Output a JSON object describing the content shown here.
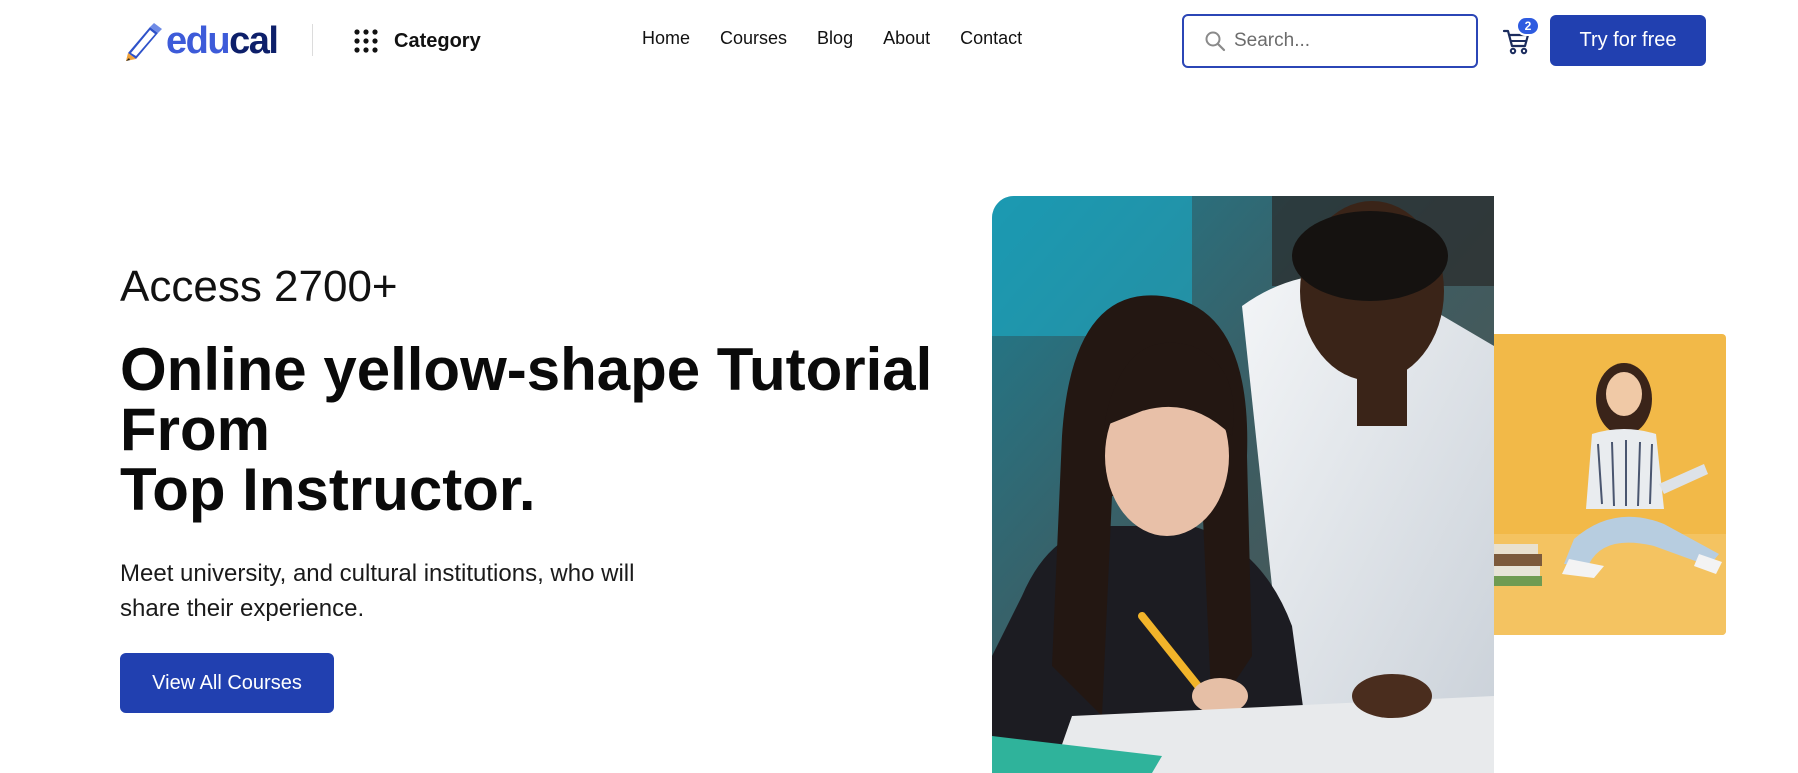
{
  "header": {
    "logo": {
      "part1": "edu",
      "part2": "cal",
      "icon": "pencil-logo-icon"
    },
    "category_label": "Category",
    "category_icon": "grid-dots-icon",
    "nav": [
      {
        "label": "Home"
      },
      {
        "label": "Courses"
      },
      {
        "label": "Blog"
      },
      {
        "label": "About"
      },
      {
        "label": "Contact"
      }
    ],
    "search": {
      "placeholder": "Search...",
      "value": "",
      "icon": "search-icon"
    },
    "cart": {
      "count": "2",
      "icon": "cart-icon"
    },
    "cta_label": "Try for free"
  },
  "hero": {
    "subtitle": "Access 2700+",
    "title_line1": "Online yellow-shape Tutorial From",
    "title_line2": "Top Instructor.",
    "description": "Meet university, and cultural institutions, who will share their experience.",
    "button_label": "View All Courses"
  },
  "colors": {
    "brand": "#2140b0",
    "logo_light": "#3d5bd9",
    "logo_dark": "#0d1f6a",
    "side_photo_background": "#f2b948"
  }
}
